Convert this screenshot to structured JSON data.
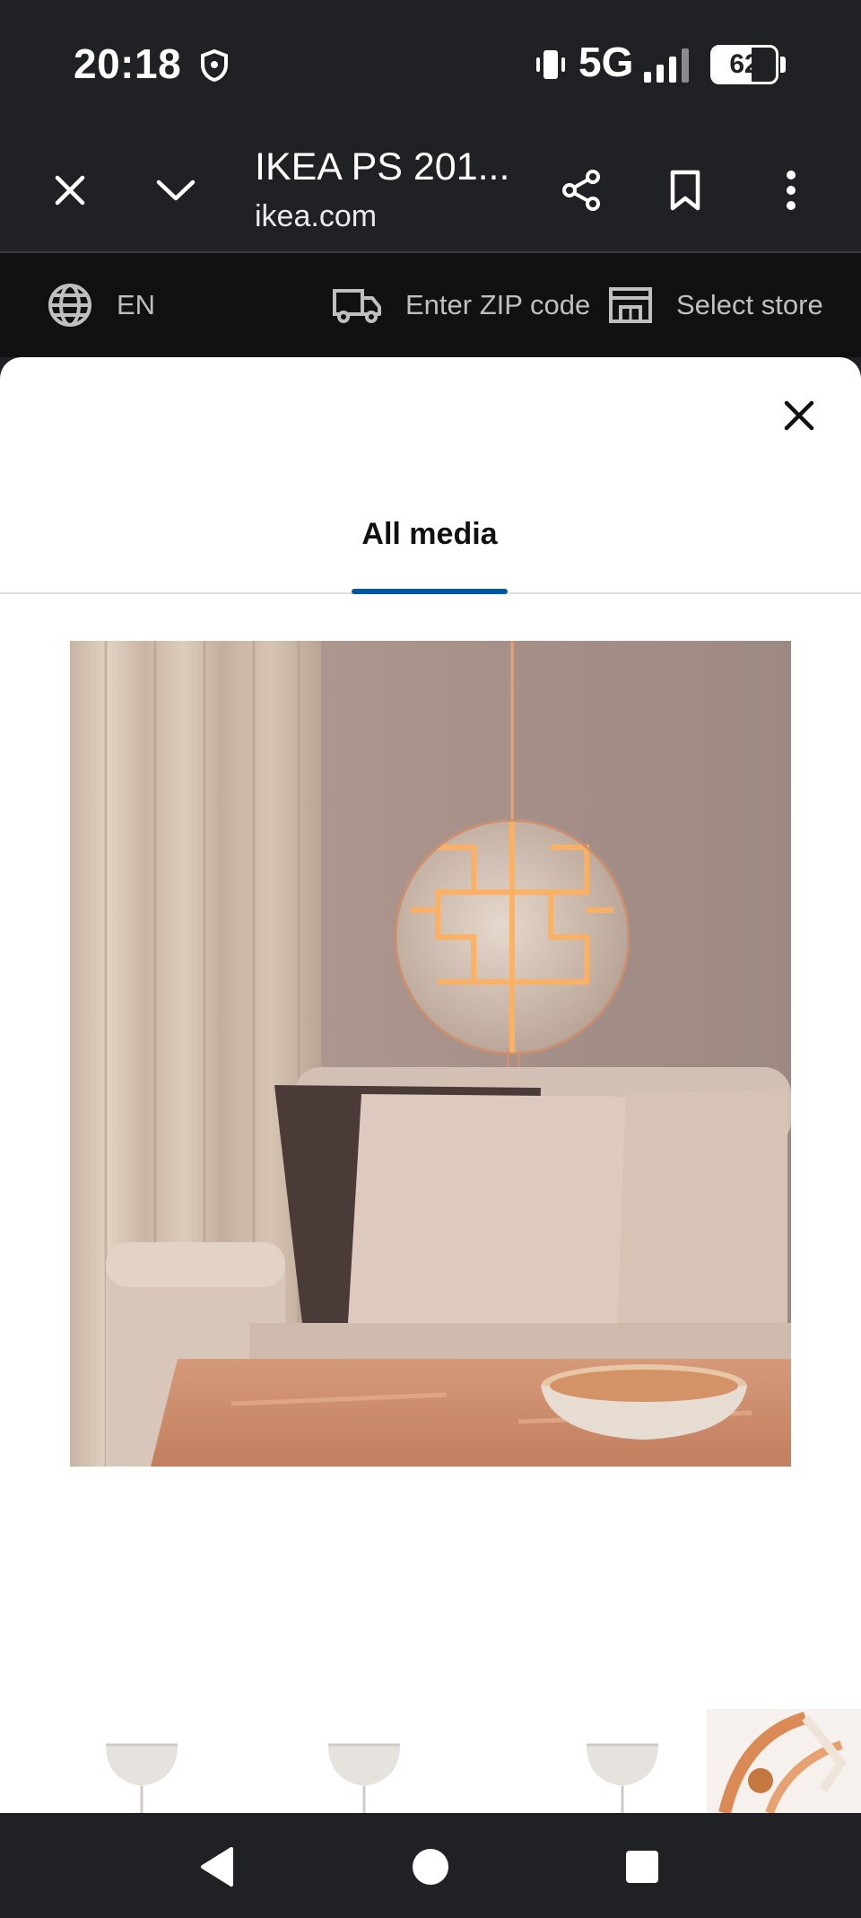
{
  "status_bar": {
    "time": "20:18",
    "network": "5G",
    "battery_percent": "62",
    "battery_level": 0.62,
    "icons": [
      "shield-icon",
      "vibrate-icon",
      "signal-icon",
      "battery-icon"
    ]
  },
  "browser": {
    "page_title": "IKEA PS 201...",
    "domain": "ikea.com",
    "icons": [
      "close-icon",
      "chevron-down-icon",
      "share-icon",
      "bookmark-icon",
      "more-vert-icon"
    ]
  },
  "utility_bar": {
    "language": "EN",
    "zip_label": "Enter ZIP code",
    "store_label": "Select store",
    "icons": [
      "globe-icon",
      "truck-icon",
      "store-icon"
    ]
  },
  "media_modal": {
    "tab_label": "All media",
    "accent_color": "#0058a3",
    "icons": [
      "close-icon"
    ]
  },
  "thumbnails": [
    {
      "name": "white-pendant-shade-thumbnail"
    },
    {
      "name": "white-pendant-shade-thumbnail"
    },
    {
      "name": "white-pendant-shade-thumbnail"
    },
    {
      "name": "copper-lamp-detail-thumbnail"
    }
  ],
  "nav_bar": {
    "icons": [
      "back-icon",
      "home-icon",
      "recents-icon"
    ]
  }
}
